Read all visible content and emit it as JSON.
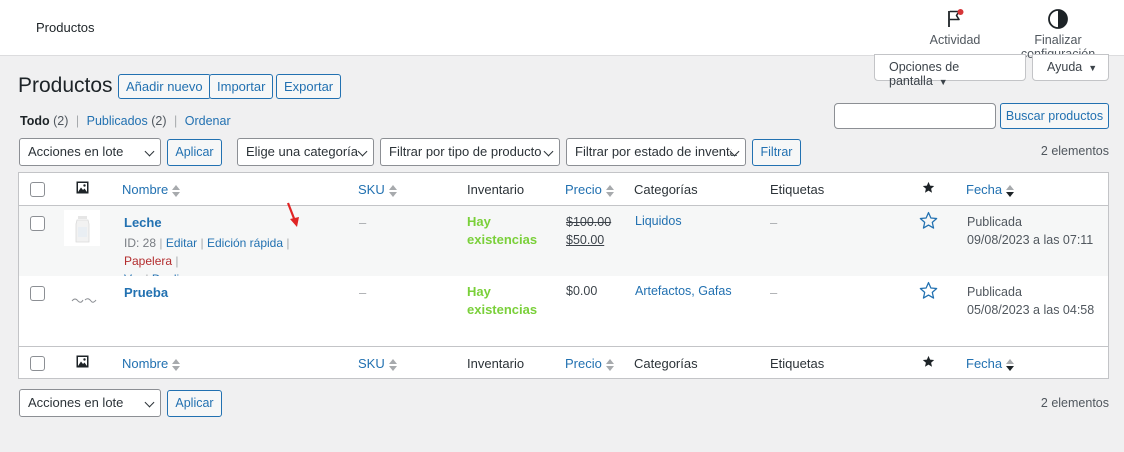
{
  "header": {
    "title": "Productos",
    "activity_label": "Actividad",
    "finish_setup_label": "Finalizar configuración"
  },
  "screen_options": {
    "label": "Opciones de pantalla",
    "help_label": "Ayuda"
  },
  "page": {
    "title": "Productos",
    "add_new": "Añadir nuevo",
    "import": "Importar",
    "export": "Exportar"
  },
  "subsub": {
    "all": "Todo",
    "all_count": "(2)",
    "published": "Publicados",
    "published_count": "(2)",
    "order": "Ordenar",
    "separator": "|"
  },
  "search": {
    "value": "",
    "button": "Buscar productos"
  },
  "filters": {
    "bulk_actions": "Acciones en lote",
    "apply": "Aplicar",
    "category": "Elige una categoría",
    "product_type": "Filtrar por tipo de producto",
    "stock_status": "Filtrar por estado de inventario",
    "filter_button": "Filtrar",
    "count": "2 elementos"
  },
  "columns": {
    "name": "Nombre",
    "sku": "SKU",
    "stock": "Inventario",
    "price": "Precio",
    "categories": "Categorías",
    "tags": "Etiquetas",
    "date": "Fecha"
  },
  "rows": [
    {
      "name": "Leche",
      "sku": "–",
      "stock_line1": "Hay",
      "stock_line2": "existencias",
      "price_regular": "$100.00",
      "price_sale": "$50.00",
      "categories": "Liquidos",
      "tags": "–",
      "status": "Publicada",
      "date": "09/08/2023 a las 07:11",
      "actions": {
        "id": "ID: 28",
        "edit": "Editar",
        "quick_edit": "Edición rápida",
        "trash": "Papelera",
        "view": "Ver",
        "duplicate": "Duplicar"
      }
    },
    {
      "name": "Prueba",
      "sku": "–",
      "stock_line1": "Hay",
      "stock_line2": "existencias",
      "price": "$0.00",
      "categories": "Artefactos, Gafas",
      "tags": "–",
      "status": "Publicada",
      "date": "05/08/2023 a las 04:58"
    }
  ],
  "colors": {
    "link": "#2271b1",
    "in_stock": "#7ad03a",
    "trash": "#b32d2e",
    "annotation_arrow": "#e02424"
  },
  "icons": [
    "flag-icon",
    "half-circle-icon",
    "image-icon",
    "star-icon",
    "star-outline-icon"
  ]
}
